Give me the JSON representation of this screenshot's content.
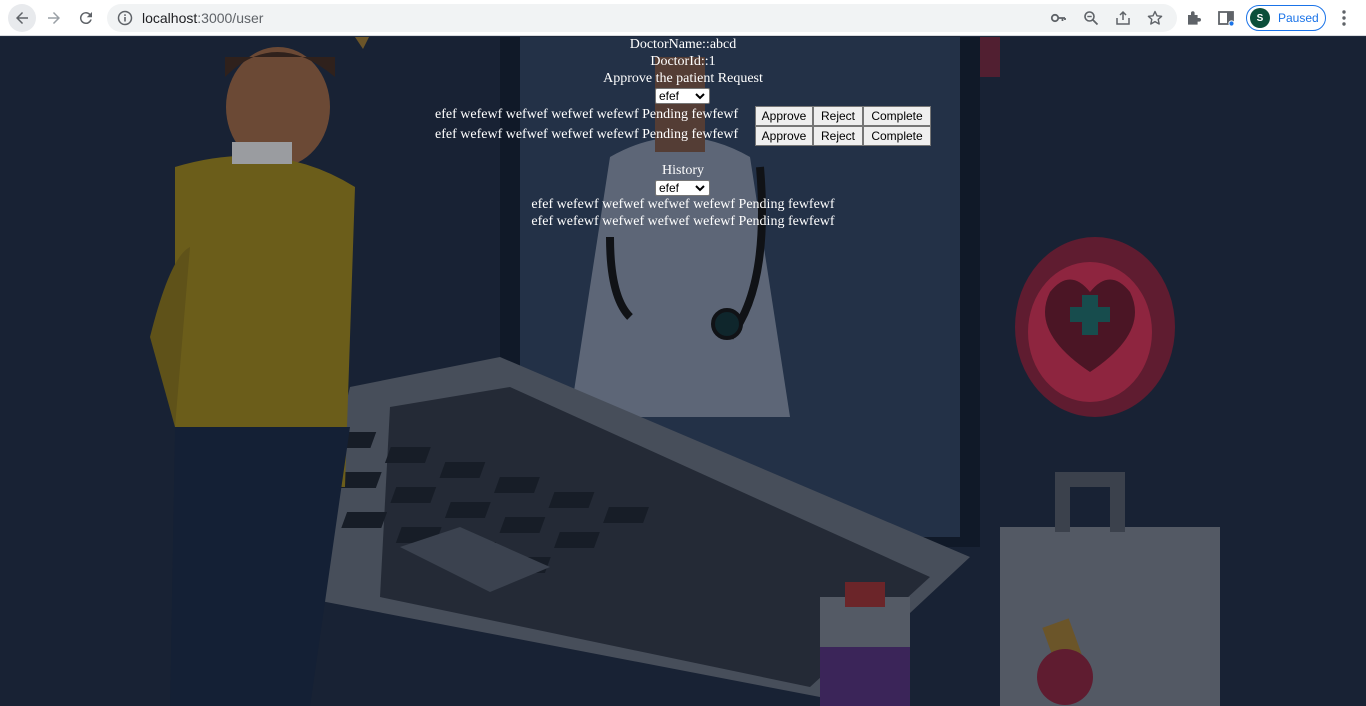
{
  "browser": {
    "url_host": "localhost",
    "url_rest": ":3000/user",
    "profile_initial": "S",
    "profile_status": "Paused"
  },
  "doctor": {
    "name_line": "DoctorName::abcd",
    "id_line": "DoctorId::1"
  },
  "requests": {
    "heading": "Approve the patient Request",
    "filter_value": "efef",
    "rows": [
      {
        "text": "efef wefewf wefwef wefwef wefewf Pending fewfewf"
      },
      {
        "text": "efef wefewf wefwef wefwef wefewf Pending fewfewf"
      }
    ],
    "approve_label": "Approve",
    "reject_label": "Reject",
    "complete_label": "Complete"
  },
  "history": {
    "heading": "History",
    "filter_value": "efef",
    "rows": [
      {
        "text": "efef wefewf wefwef wefwef wefewf Pending fewfewf"
      },
      {
        "text": "efef wefewf wefwef wefwef wefewf Pending fewfewf"
      }
    ]
  }
}
